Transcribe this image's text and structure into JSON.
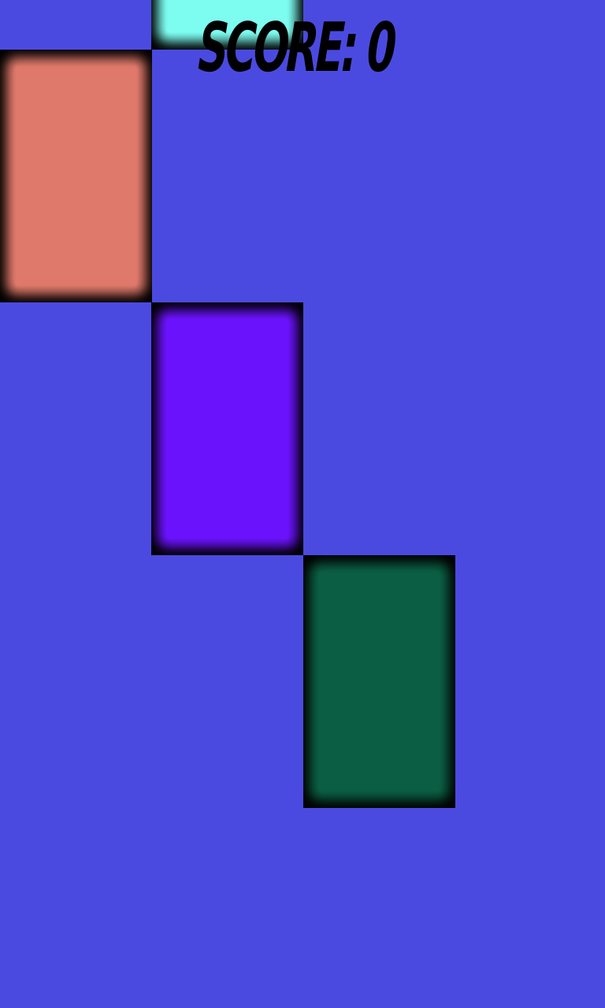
{
  "hud": {
    "score_text": "SCORE: 0"
  },
  "colors": {
    "background": "#4b4ae0",
    "tile_border": "#000000"
  },
  "tiles": [
    {
      "name": "tile-cyan",
      "color": "#7dfcf0"
    },
    {
      "name": "tile-salmon",
      "color": "#df796b"
    },
    {
      "name": "tile-violet",
      "color": "#6b12fd"
    },
    {
      "name": "tile-green",
      "color": "#0b5e43"
    }
  ]
}
